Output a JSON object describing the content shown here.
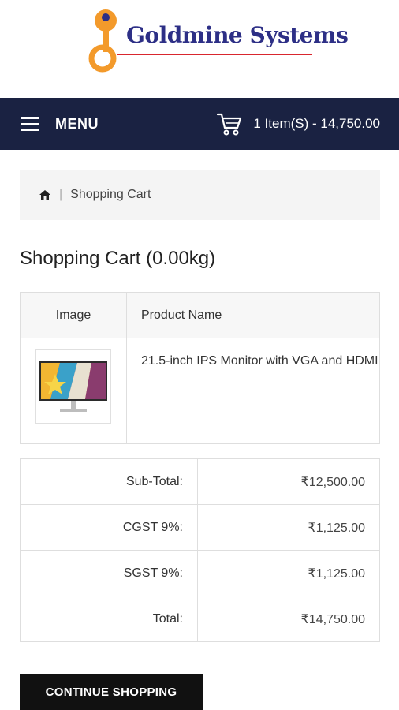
{
  "brand": {
    "name": "Goldmine Systems",
    "accent": "#d9262e",
    "primary": "#2d2f86"
  },
  "navbar": {
    "menu_label": "MENU",
    "cart_summary": "1 Item(S) - 14,750.00",
    "background": "#1a2242"
  },
  "breadcrumb": {
    "home_icon": "home-icon",
    "current": "Shopping Cart"
  },
  "page": {
    "title": "Shopping Cart  (0.00kg)"
  },
  "cart_table": {
    "headers": {
      "image": "Image",
      "product_name": "Product Name"
    },
    "items": [
      {
        "name": "21.5-inch IPS Monitor with VGA and HDMI",
        "image_icon": "monitor-icon"
      }
    ]
  },
  "totals": [
    {
      "label": "Sub-Total:",
      "value": "₹12,500.00"
    },
    {
      "label": "CGST 9%:",
      "value": "₹1,125.00"
    },
    {
      "label": "SGST 9%:",
      "value": "₹1,125.00"
    },
    {
      "label": "Total:",
      "value": "₹14,750.00"
    }
  ],
  "actions": {
    "continue_label": "CONTINUE SHOPPING"
  }
}
